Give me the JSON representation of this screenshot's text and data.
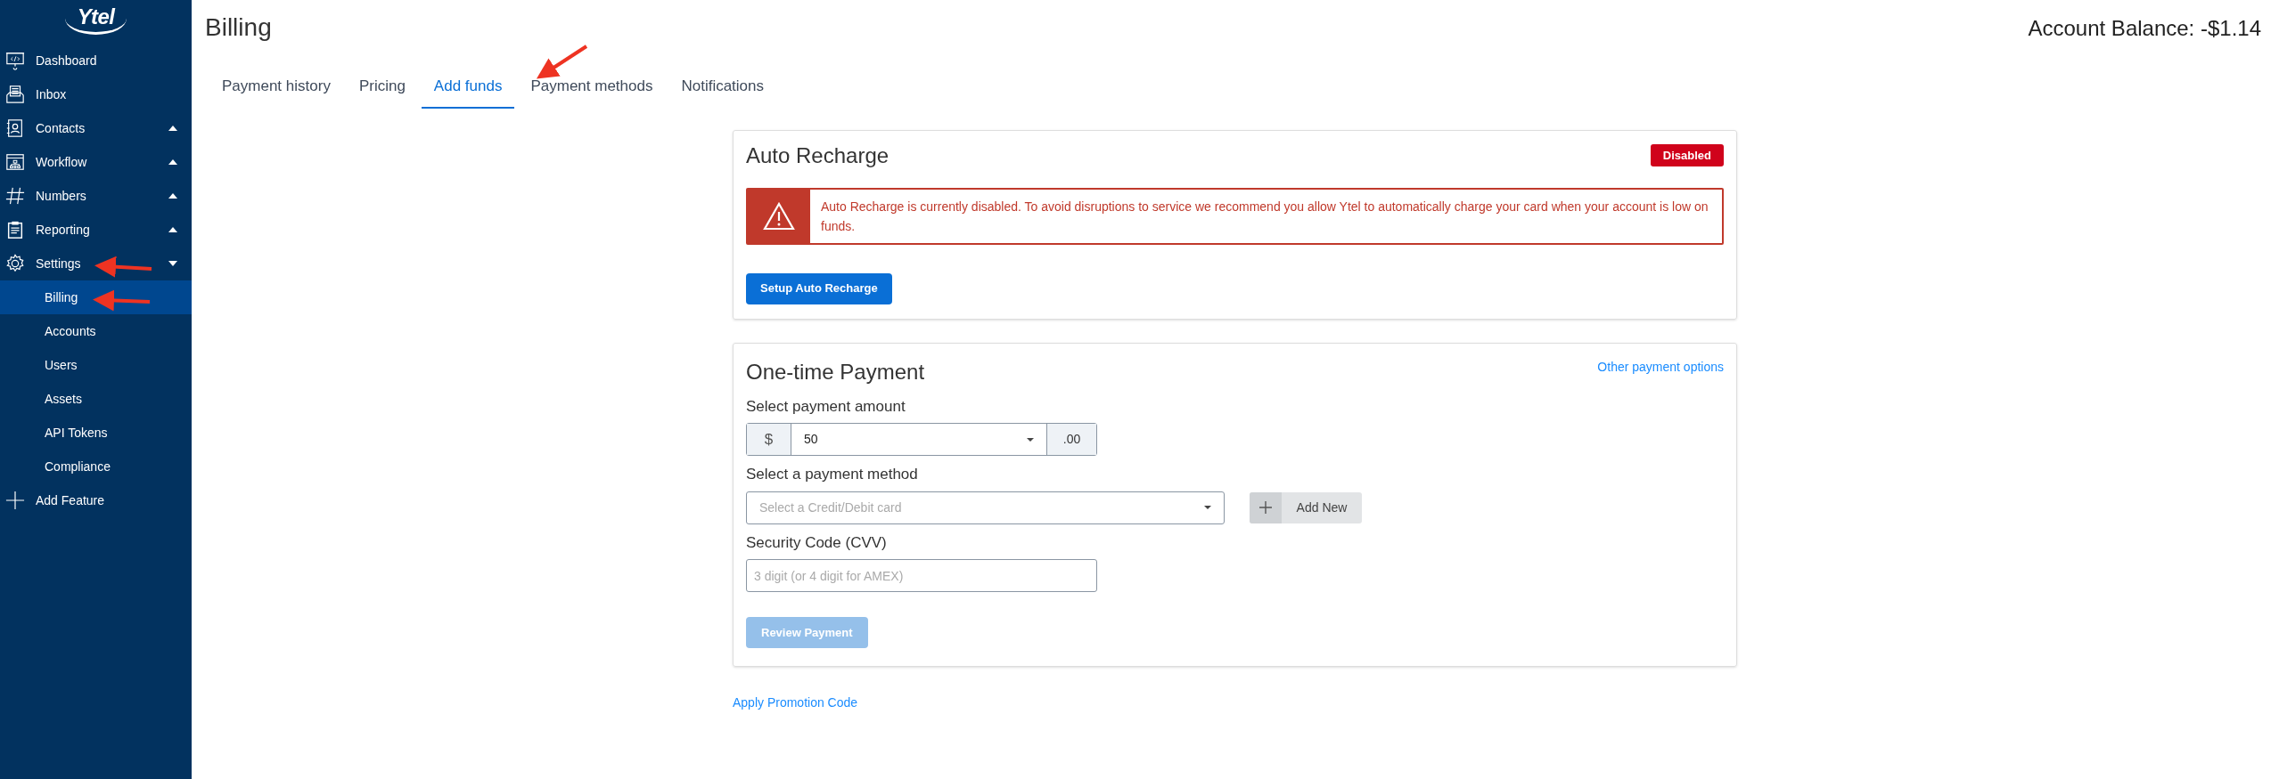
{
  "sidebar": {
    "logo": "Ytel",
    "items": [
      {
        "label": "Dashboard",
        "selected": false
      },
      {
        "label": "Inbox",
        "selected": false
      },
      {
        "label": "Contacts",
        "expanded": false,
        "selected": false
      },
      {
        "label": "Workflow",
        "expanded": false,
        "selected": false
      },
      {
        "label": "Numbers",
        "expanded": false,
        "selected": false
      },
      {
        "label": "Reporting",
        "expanded": false,
        "selected": false
      },
      {
        "label": "Settings",
        "expanded": true,
        "selected": false,
        "children": [
          {
            "label": "Billing",
            "selected": true
          },
          {
            "label": "Accounts",
            "selected": false
          },
          {
            "label": "Users",
            "selected": false
          },
          {
            "label": "Assets",
            "selected": false
          },
          {
            "label": "API Tokens",
            "selected": false
          },
          {
            "label": "Compliance",
            "selected": false
          }
        ]
      },
      {
        "label": "Add Feature",
        "selected": false
      }
    ]
  },
  "header": {
    "title": "Billing",
    "balance": "Account Balance: **-$1.14**"
  },
  "tabs": [
    {
      "label": "Payment history",
      "selected": false
    },
    {
      "label": "Pricing",
      "selected": false
    },
    {
      "label": "Add funds",
      "selected": true
    },
    {
      "label": "Payment methods",
      "selected": false
    },
    {
      "label": "Notifications",
      "selected": false
    }
  ],
  "auto_recharge": {
    "title": "Auto Recharge",
    "status": "Disabled",
    "enabled": false,
    "alert": "Auto Recharge is currently disabled. To avoid disruptions to service we recommend you allow Ytel to automatically charge your card when your account is low on funds.",
    "button": "Setup Auto Recharge"
  },
  "one_time_payment": {
    "title": "One-time Payment",
    "other_link": "Other payment options",
    "amount": {
      "label": "Select payment amount",
      "prefix": "$",
      "value": "50",
      "suffix": ".00"
    },
    "method": {
      "label": "Select a payment method",
      "placeholder": "Select a Credit/Debit card",
      "add_button": "Add New"
    },
    "cvv": {
      "label": "Security Code (CVV)",
      "placeholder": "3 digit (or 4 digit for AMEX)"
    },
    "review_button": {
      "label": "Review Payment",
      "disabled": true
    }
  },
  "promo_link": "Apply Promotion Code"
}
